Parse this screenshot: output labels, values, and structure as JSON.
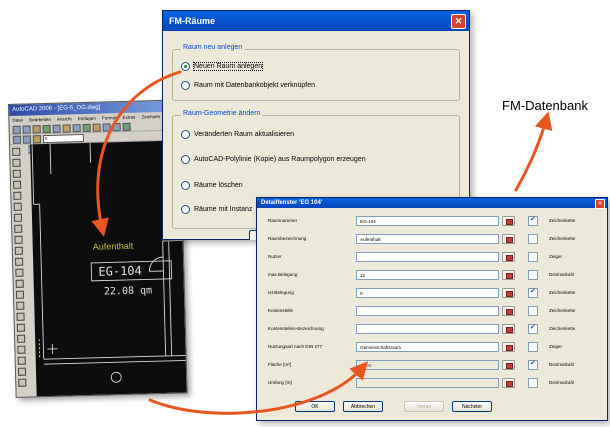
{
  "annotation": {
    "fm_datenbank": "FM-Datenbank"
  },
  "autocad": {
    "title": "AutoCAD 2006 - [EG-5_OG.dwg]",
    "menu": [
      "Datei",
      "Bearbeiten",
      "Ansicht",
      "Einfügen",
      "Format",
      "Extras",
      "Zeichnen"
    ],
    "layer_value": "0",
    "drawing": {
      "room_name": "Aufenthalt",
      "room_number": "EG-104",
      "area": "22.08 qm"
    }
  },
  "fm_dialog": {
    "title": "FM-Räume",
    "group1": {
      "title": "Raum neu anlegen",
      "options": [
        {
          "label": "Neuen Raum anlegen",
          "selected": true
        },
        {
          "label": "Raum mit Datenbankobjekt verknüpfen",
          "selected": false
        }
      ]
    },
    "group2": {
      "title": "Raum-Geometrie ändern",
      "options": [
        {
          "label": "Veränderten Raum aktualisieren",
          "selected": false
        },
        {
          "label": "AutoCAD-Polylinie (Kopie) aus Raumpolygon erzeugen",
          "selected": false
        },
        {
          "label": "Räume löschen",
          "selected": false
        },
        {
          "label": "Räume mit Instanz",
          "selected": false
        }
      ]
    }
  },
  "detail": {
    "title": "Detailfenster 'EG 104'",
    "rows": [
      {
        "label": "Raumnummer",
        "value": "EG-104",
        "checked": true,
        "type": "Zeichenkette",
        "readonly": false
      },
      {
        "label": "Raumbezeichnung",
        "value": "Aufenthalt",
        "checked": false,
        "type": "Zeichenkette",
        "readonly": false
      },
      {
        "label": "Nutzer",
        "value": "",
        "checked": false,
        "type": "Zeiger",
        "readonly": false
      },
      {
        "label": "max.Belegung",
        "value": "12",
        "checked": false,
        "type": "Dezimalzahl",
        "readonly": false
      },
      {
        "label": "Ist-Belegung",
        "value": "0",
        "checked": true,
        "type": "Zeichenkette",
        "readonly": false
      },
      {
        "label": "Kostenstelle",
        "value": "",
        "checked": false,
        "type": "Zeichenkette",
        "readonly": false
      },
      {
        "label": "Kostenstellen-Bezeichnung",
        "value": "",
        "checked": true,
        "type": "Zeichenkette",
        "readonly": false
      },
      {
        "label": "Nutzungsart nach DIN 277",
        "value": "Gemeinschaftsraum",
        "checked": false,
        "type": "Zeiger",
        "readonly": false
      },
      {
        "label": "Fläche [m²]",
        "value": "22.08",
        "checked": true,
        "type": "Dezimalzahl",
        "readonly": true
      },
      {
        "label": "Umfang [m]",
        "value": "",
        "checked": false,
        "type": "Dezimalzahl",
        "readonly": true
      }
    ],
    "buttons": {
      "ok": "OK",
      "cancel": "Abbrechen",
      "prev": "Vorher",
      "next": "Nächster"
    }
  }
}
